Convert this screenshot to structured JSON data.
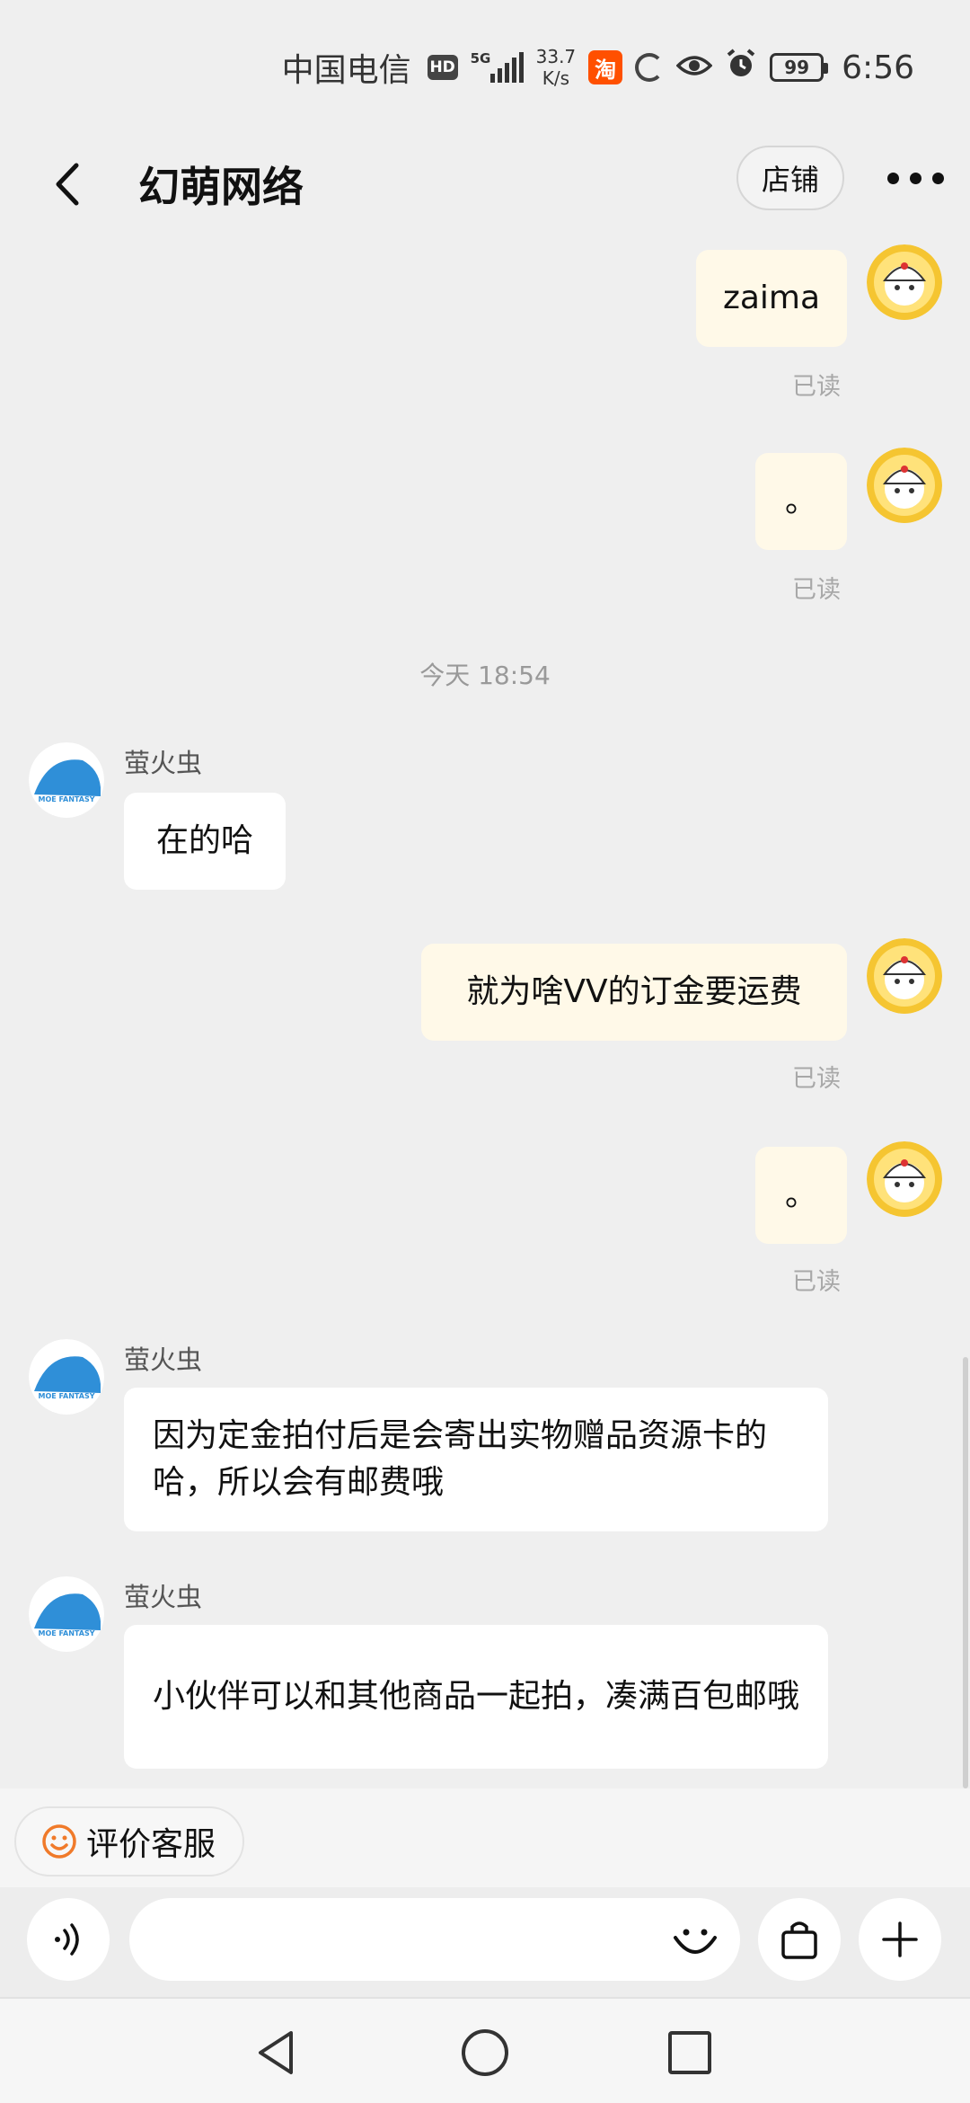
{
  "status_bar": {
    "carrier": "中国电信",
    "hd": "HD",
    "network": "5G",
    "speed_value": "33.7",
    "speed_unit": "K/s",
    "taobao_badge": "淘",
    "battery": "99",
    "time": "6:56"
  },
  "header": {
    "title": "幻萌网络",
    "shop_label": "店铺",
    "back_icon": "chevron-left-icon",
    "more_icon": "more-dots-icon"
  },
  "chat": {
    "divider_time": "今天  18:54",
    "read_label": "已读",
    "messages": [
      {
        "from": "self",
        "text": "zaima",
        "read": "已读"
      },
      {
        "from": "self",
        "text": "。",
        "read": "已读"
      },
      {
        "from": "other",
        "sender": "萤火虫",
        "text": "在的哈"
      },
      {
        "from": "self",
        "text": "就为啥VV的订金要运费",
        "read": "已读"
      },
      {
        "from": "self",
        "text": "。",
        "read": "已读"
      },
      {
        "from": "other",
        "sender": "萤火虫",
        "text": "因为定金拍付后是会寄出实物赠品资源卡的哈，所以会有邮费哦"
      },
      {
        "from": "other",
        "sender": "萤火虫",
        "text": "小伙伴可以和其他商品一起拍，凑满百包邮哦"
      }
    ]
  },
  "quick_actions": {
    "rate_service": "评价客服"
  },
  "input_bar": {
    "voice_icon": "voice-icon",
    "emoji_icon": "emoji-icon",
    "bag_icon": "shopping-bag-icon",
    "plus_icon": "plus-icon"
  },
  "colors": {
    "self_bubble": "#fff9e8",
    "other_bubble": "#ffffff",
    "background": "#efefef",
    "rate_icon": "#f07a2a"
  }
}
